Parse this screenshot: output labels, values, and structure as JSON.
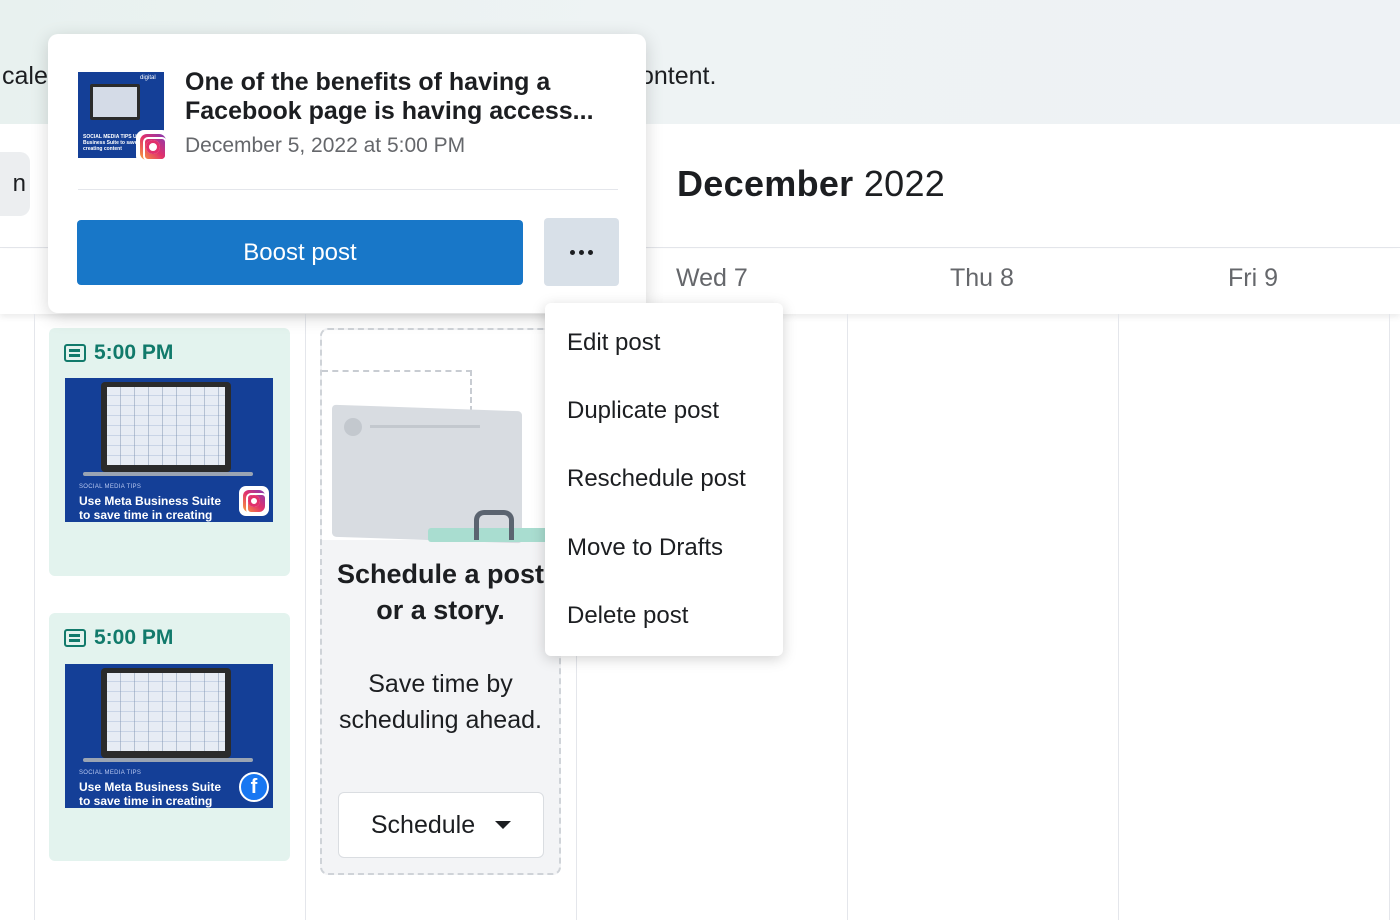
{
  "banner": {
    "left_text": "cale",
    "right_text": "ontent."
  },
  "header": {
    "left_button_label": "n",
    "month": "December",
    "year": "2022"
  },
  "day_columns": {
    "wed": "Wed 7",
    "thu": "Thu 8",
    "fri": "Fri 9"
  },
  "posts": [
    {
      "time": "5:00 PM",
      "tip_label": "SOCIAL MEDIA TIPS",
      "tip_title": "Use Meta Business Suite",
      "tip_title_line2": "to save time in creating",
      "platform": "instagram-icon"
    },
    {
      "time": "5:00 PM",
      "tip_label": "SOCIAL MEDIA TIPS",
      "tip_title": "Use Meta Business Suite",
      "tip_title_line2": "to save time in creating",
      "platform": "facebook-icon"
    }
  ],
  "schedule_prompt": {
    "title": "Schedule a post or a story.",
    "subtitle": "Save time by scheduling ahead.",
    "button_label": "Schedule"
  },
  "popover": {
    "title": "One of the benefits of having a Facebook page is having access...",
    "date": "December 5, 2022 at 5:00 PM",
    "boost_label": "Boost post",
    "thumb_brand": "digital",
    "thumb_text": "SOCIAL MEDIA TIPS Use Meta Business Suite to save time in creating content"
  },
  "more_menu": {
    "items": [
      "Edit post",
      "Duplicate post",
      "Reschedule post",
      "Move to Drafts",
      "Delete post"
    ]
  },
  "colors": {
    "accent": "#1877c8",
    "post_bg": "#e3f3ee",
    "time_green": "#117a6b",
    "thumb_blue": "#143f97"
  }
}
